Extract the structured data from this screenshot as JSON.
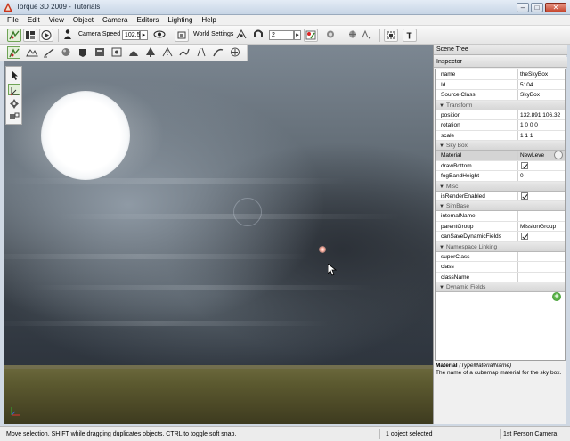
{
  "window": {
    "title": "Torque 3D 2009 - Tutorials"
  },
  "menu": [
    "File",
    "Edit",
    "View",
    "Object",
    "Camera",
    "Editors",
    "Lighting",
    "Help"
  ],
  "toolbar": {
    "camera_speed_label": "Camera Speed",
    "camera_speed_value": "102.5",
    "world_settings_label": "World Settings",
    "grid_value": "2",
    "icons": [
      "world-editor-icon",
      "layout-icon",
      "play-icon",
      "player-icon",
      "visibility-icon",
      "camera-select-icon",
      "snap-icon",
      "magnet-icon",
      "lighting-icon",
      "sun-icon",
      "bounds-icon",
      "dropdown-icon",
      "fit-icon",
      "text-icon"
    ]
  },
  "toolbar2_icons": [
    "object-editor-icon",
    "terrain-editor-icon",
    "terrain-painter-icon",
    "material-editor-icon",
    "sketch-tool-icon",
    "datablock-editor-icon",
    "particle-editor-icon",
    "decal-editor-icon",
    "forest-editor-icon",
    "mesh-road-icon",
    "river-editor-icon",
    "road-editor-icon",
    "shape-editor-icon",
    "nav-icon"
  ],
  "palette_icons": [
    "select-arrow-icon",
    "move-tool-icon",
    "rotate-tool-icon",
    "scale-tool-icon"
  ],
  "panel": {
    "scene_tree": "Scene Tree",
    "inspector": "Inspector",
    "top_rows": [
      {
        "key": "name",
        "value": "theSkyBox"
      },
      {
        "key": "Id",
        "value": "5104"
      },
      {
        "key": "Source Class",
        "value": "SkyBox"
      }
    ],
    "transform": {
      "title": "Transform",
      "rows": [
        {
          "key": "position",
          "value": "132.891 106.32"
        },
        {
          "key": "rotation",
          "value": "1 0 0 0"
        },
        {
          "key": "scale",
          "value": "1 1 1"
        }
      ]
    },
    "skybox": {
      "title": "Sky Box",
      "material_key": "Material",
      "material_value": "NewLeve",
      "drawbottom_key": "drawBottom",
      "fogband_key": "fogBandHeight",
      "fogband_value": "0"
    },
    "misc": {
      "title": "Misc",
      "render_key": "isRenderEnabled"
    },
    "simbase": {
      "title": "SimBase",
      "internal_key": "internalName",
      "internal_value": "",
      "parent_key": "parentGroup",
      "parent_value": "MissionGroup",
      "cansave_key": "canSaveDynamicFields"
    },
    "namespace": {
      "title": "Namespace Linking",
      "rows": [
        {
          "key": "superClass",
          "value": ""
        },
        {
          "key": "class",
          "value": ""
        },
        {
          "key": "className",
          "value": ""
        }
      ]
    },
    "dynamic": {
      "title": "Dynamic Fields"
    },
    "description": {
      "field": "Material",
      "type": "(TypeMaterialName)",
      "text": "The name of a cubemap material for the sky box."
    }
  },
  "status": {
    "hint": "Move selection.  SHIFT while dragging duplicates objects.  CTRL to toggle soft snap.",
    "selection": "1 object selected",
    "camera": "1st Person Camera"
  },
  "colors": {
    "accent": "#4a8a2c",
    "sun": "#ffffff",
    "ground": "#5c5a30",
    "sky": "#5d6770"
  }
}
